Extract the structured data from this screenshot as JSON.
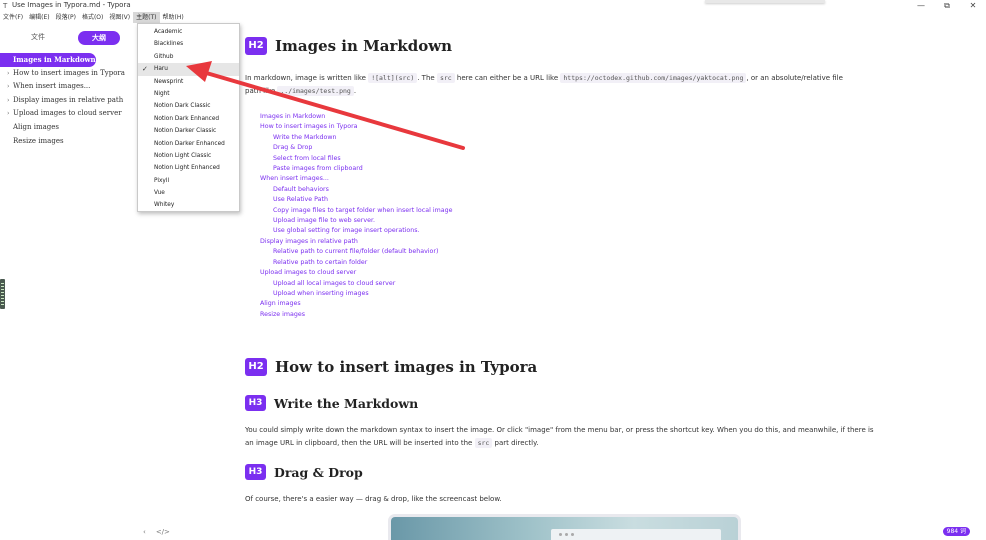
{
  "window": {
    "icon": "T",
    "title": "Use Images in Typora.md - Typora",
    "controls": {
      "minimize": "—",
      "maximize": "⧉",
      "close": "✕"
    }
  },
  "menubar": [
    {
      "label": "文件(F)",
      "active": false
    },
    {
      "label": "编辑(E)",
      "active": false
    },
    {
      "label": "段落(P)",
      "active": false
    },
    {
      "label": "格式(O)",
      "active": false
    },
    {
      "label": "视图(V)",
      "active": false
    },
    {
      "label": "主题(T)",
      "active": true
    },
    {
      "label": "帮助(H)",
      "active": false
    }
  ],
  "sidebar": {
    "tab_files": "文件",
    "tab_outline": "大纲",
    "items": [
      {
        "label": "Images in Markdown",
        "active": true,
        "caret": ""
      },
      {
        "label": "How to insert images in Typora",
        "active": false,
        "caret": "›"
      },
      {
        "label": "When insert images...",
        "active": false,
        "caret": "›"
      },
      {
        "label": "Display images in relative path",
        "active": false,
        "caret": "›"
      },
      {
        "label": "Upload images to cloud server",
        "active": false,
        "caret": "›"
      },
      {
        "label": "Align images",
        "active": false,
        "caret": ""
      },
      {
        "label": "Resize images",
        "active": false,
        "caret": ""
      }
    ],
    "footer_back": "‹",
    "footer_source": "</>"
  },
  "theme_menu": {
    "items": [
      {
        "label": "Academic",
        "checked": false
      },
      {
        "label": "Blacklines",
        "checked": false
      },
      {
        "label": "Github",
        "checked": false
      },
      {
        "label": "Haru",
        "checked": true
      },
      {
        "label": "Newsprint",
        "checked": false
      },
      {
        "label": "Night",
        "checked": false
      },
      {
        "label": "Notion Dark Classic",
        "checked": false
      },
      {
        "label": "Notion Dark Enhanced",
        "checked": false
      },
      {
        "label": "Notion Darker Classic",
        "checked": false
      },
      {
        "label": "Notion Darker Enhanced",
        "checked": false
      },
      {
        "label": "Notion Light Classic",
        "checked": false
      },
      {
        "label": "Notion Light Enhanced",
        "checked": false
      },
      {
        "label": "Pixyll",
        "checked": false
      },
      {
        "label": "Vue",
        "checked": false
      },
      {
        "label": "Whitey",
        "checked": false
      }
    ],
    "check_glyph": "✓"
  },
  "document": {
    "h_images_badge": "H2",
    "h_images": "Images in Markdown",
    "intro_part1": "In markdown, image is written like ",
    "intro_code1": "![alt](src)",
    "intro_part2": ". The ",
    "intro_code2": "src",
    "intro_part3": " here can either be a URL like ",
    "intro_code3": "https://octodex.github.com/images/yaktocat.png",
    "intro_part4": ", or an absolute/relative file",
    "intro_line2_part1": "path like ",
    "intro_code4": "../images/test.png",
    "intro_line2_part2": ".",
    "toc": [
      {
        "label": "Images in Markdown",
        "level": 1
      },
      {
        "label": "How to insert images in Typora",
        "level": 1
      },
      {
        "label": "Write the Markdown",
        "level": 2
      },
      {
        "label": "Drag & Drop",
        "level": 2
      },
      {
        "label": "Select from local files",
        "level": 2
      },
      {
        "label": "Paste images from clipboard",
        "level": 2
      },
      {
        "label": "When insert images...",
        "level": 1
      },
      {
        "label": "Default behaviors",
        "level": 2
      },
      {
        "label": "Use Relative Path",
        "level": 2
      },
      {
        "label": "Copy image files to target folder when insert local image",
        "level": 2
      },
      {
        "label": "Upload image file to web server.",
        "level": 2
      },
      {
        "label": "Use global setting for image insert operations.",
        "level": 2
      },
      {
        "label": "Display images in relative path",
        "level": 1
      },
      {
        "label": "Relative path to current file/folder (default behavior)",
        "level": 2
      },
      {
        "label": "Relative path to certain folder",
        "level": 2
      },
      {
        "label": "Upload images to cloud server",
        "level": 1
      },
      {
        "label": "Upload all local images to cloud server",
        "level": 2
      },
      {
        "label": "Upload when inserting images",
        "level": 2
      },
      {
        "label": "Align images",
        "level": 1
      },
      {
        "label": "Resize images",
        "level": 1
      }
    ],
    "h_insert_badge": "H2",
    "h_insert": "How to insert images in Typora",
    "h_write_badge": "H3",
    "h_write": "Write the Markdown",
    "write_part1": "You could simply write down the markdown syntax to insert the image. Or click \"image\" from the menu bar, or press the shortcut key. When you do this, and meanwhile, if there is",
    "write_part2": "an image URL in clipboard, then the URL will be inserted into the ",
    "write_code": "src",
    "write_part3": " part directly.",
    "h_drag_badge": "H3",
    "h_drag": "Drag & Drop",
    "drag_text": "Of course, there's a easier way — drag & drop, like the screencast below."
  },
  "status": {
    "word_count": "984 词"
  },
  "colors": {
    "accent": "#7b2ff0",
    "arrow": "#e8383d"
  }
}
